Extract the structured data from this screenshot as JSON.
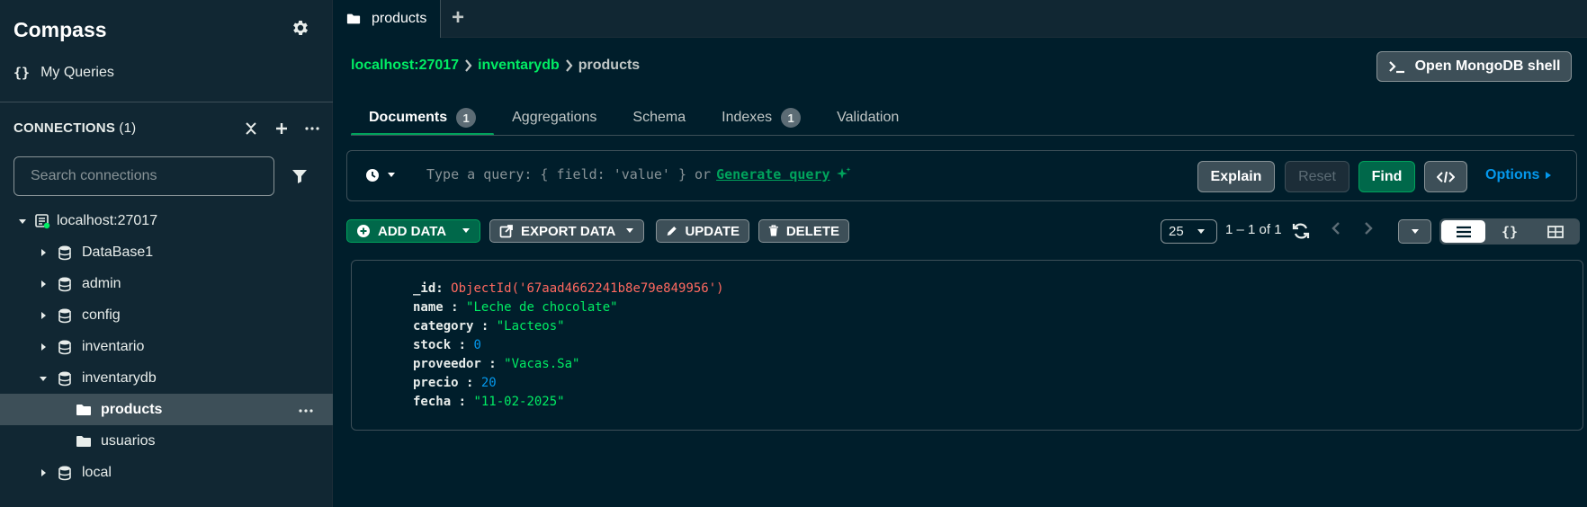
{
  "sidebar": {
    "brand": "Compass",
    "my_queries": "My Queries",
    "connections_title": "CONNECTIONS",
    "connections_count": "(1)",
    "search_placeholder": "Search connections",
    "tree": [
      {
        "label": "localhost:27017",
        "type": "connection",
        "expanded": true
      },
      {
        "label": "DataBase1",
        "type": "database",
        "expanded": false
      },
      {
        "label": "admin",
        "type": "database",
        "expanded": false
      },
      {
        "label": "config",
        "type": "database",
        "expanded": false
      },
      {
        "label": "inventario",
        "type": "database",
        "expanded": false
      },
      {
        "label": "inventarydb",
        "type": "database",
        "expanded": true
      },
      {
        "label": "products",
        "type": "collection",
        "selected": true
      },
      {
        "label": "usuarios",
        "type": "collection"
      },
      {
        "label": "local",
        "type": "database",
        "expanded": false
      }
    ]
  },
  "tabs": {
    "active_tab": "products",
    "new_tab": "+"
  },
  "breadcrumb": {
    "host": "localhost:27017",
    "db": "inventarydb",
    "collection": "products"
  },
  "shell_button": "Open MongoDB shell",
  "subtabs": [
    {
      "label": "Documents",
      "badge": "1",
      "active": true
    },
    {
      "label": "Aggregations",
      "badge": ""
    },
    {
      "label": "Schema",
      "badge": ""
    },
    {
      "label": "Indexes",
      "badge": "1"
    },
    {
      "label": "Validation",
      "badge": ""
    }
  ],
  "query": {
    "placeholder": "Type a query: { field: 'value' } or",
    "generate": "Generate query",
    "explain": "Explain",
    "reset": "Reset",
    "find": "Find",
    "options": "Options"
  },
  "toolbar": {
    "add_data": "ADD DATA",
    "export_data": "EXPORT DATA",
    "update": "UPDATE",
    "delete": "DELETE",
    "page_size": "25",
    "page_count": "1 – 1 of 1"
  },
  "document": {
    "id_key": "_id",
    "id_value": "ObjectId('67aad4662241b8e79e849956')",
    "name_key": "name",
    "name_value": "\"Leche de chocolate\"",
    "category_key": "category",
    "category_value": "\"Lacteos\"",
    "stock_key": "stock",
    "stock_value": "0",
    "proveedor_key": "proveedor",
    "proveedor_value": "\"Vacas.Sa\"",
    "precio_key": "precio",
    "precio_value": "20",
    "fecha_key": "fecha",
    "fecha_value": "\"11-02-2025\""
  },
  "colors": {
    "background": "#001e2b",
    "sidebar": "#112733",
    "accent_green": "#00ed64",
    "button_green": "#00684a",
    "link_blue": "#0498ec",
    "objectid_red": "#ff6960"
  }
}
